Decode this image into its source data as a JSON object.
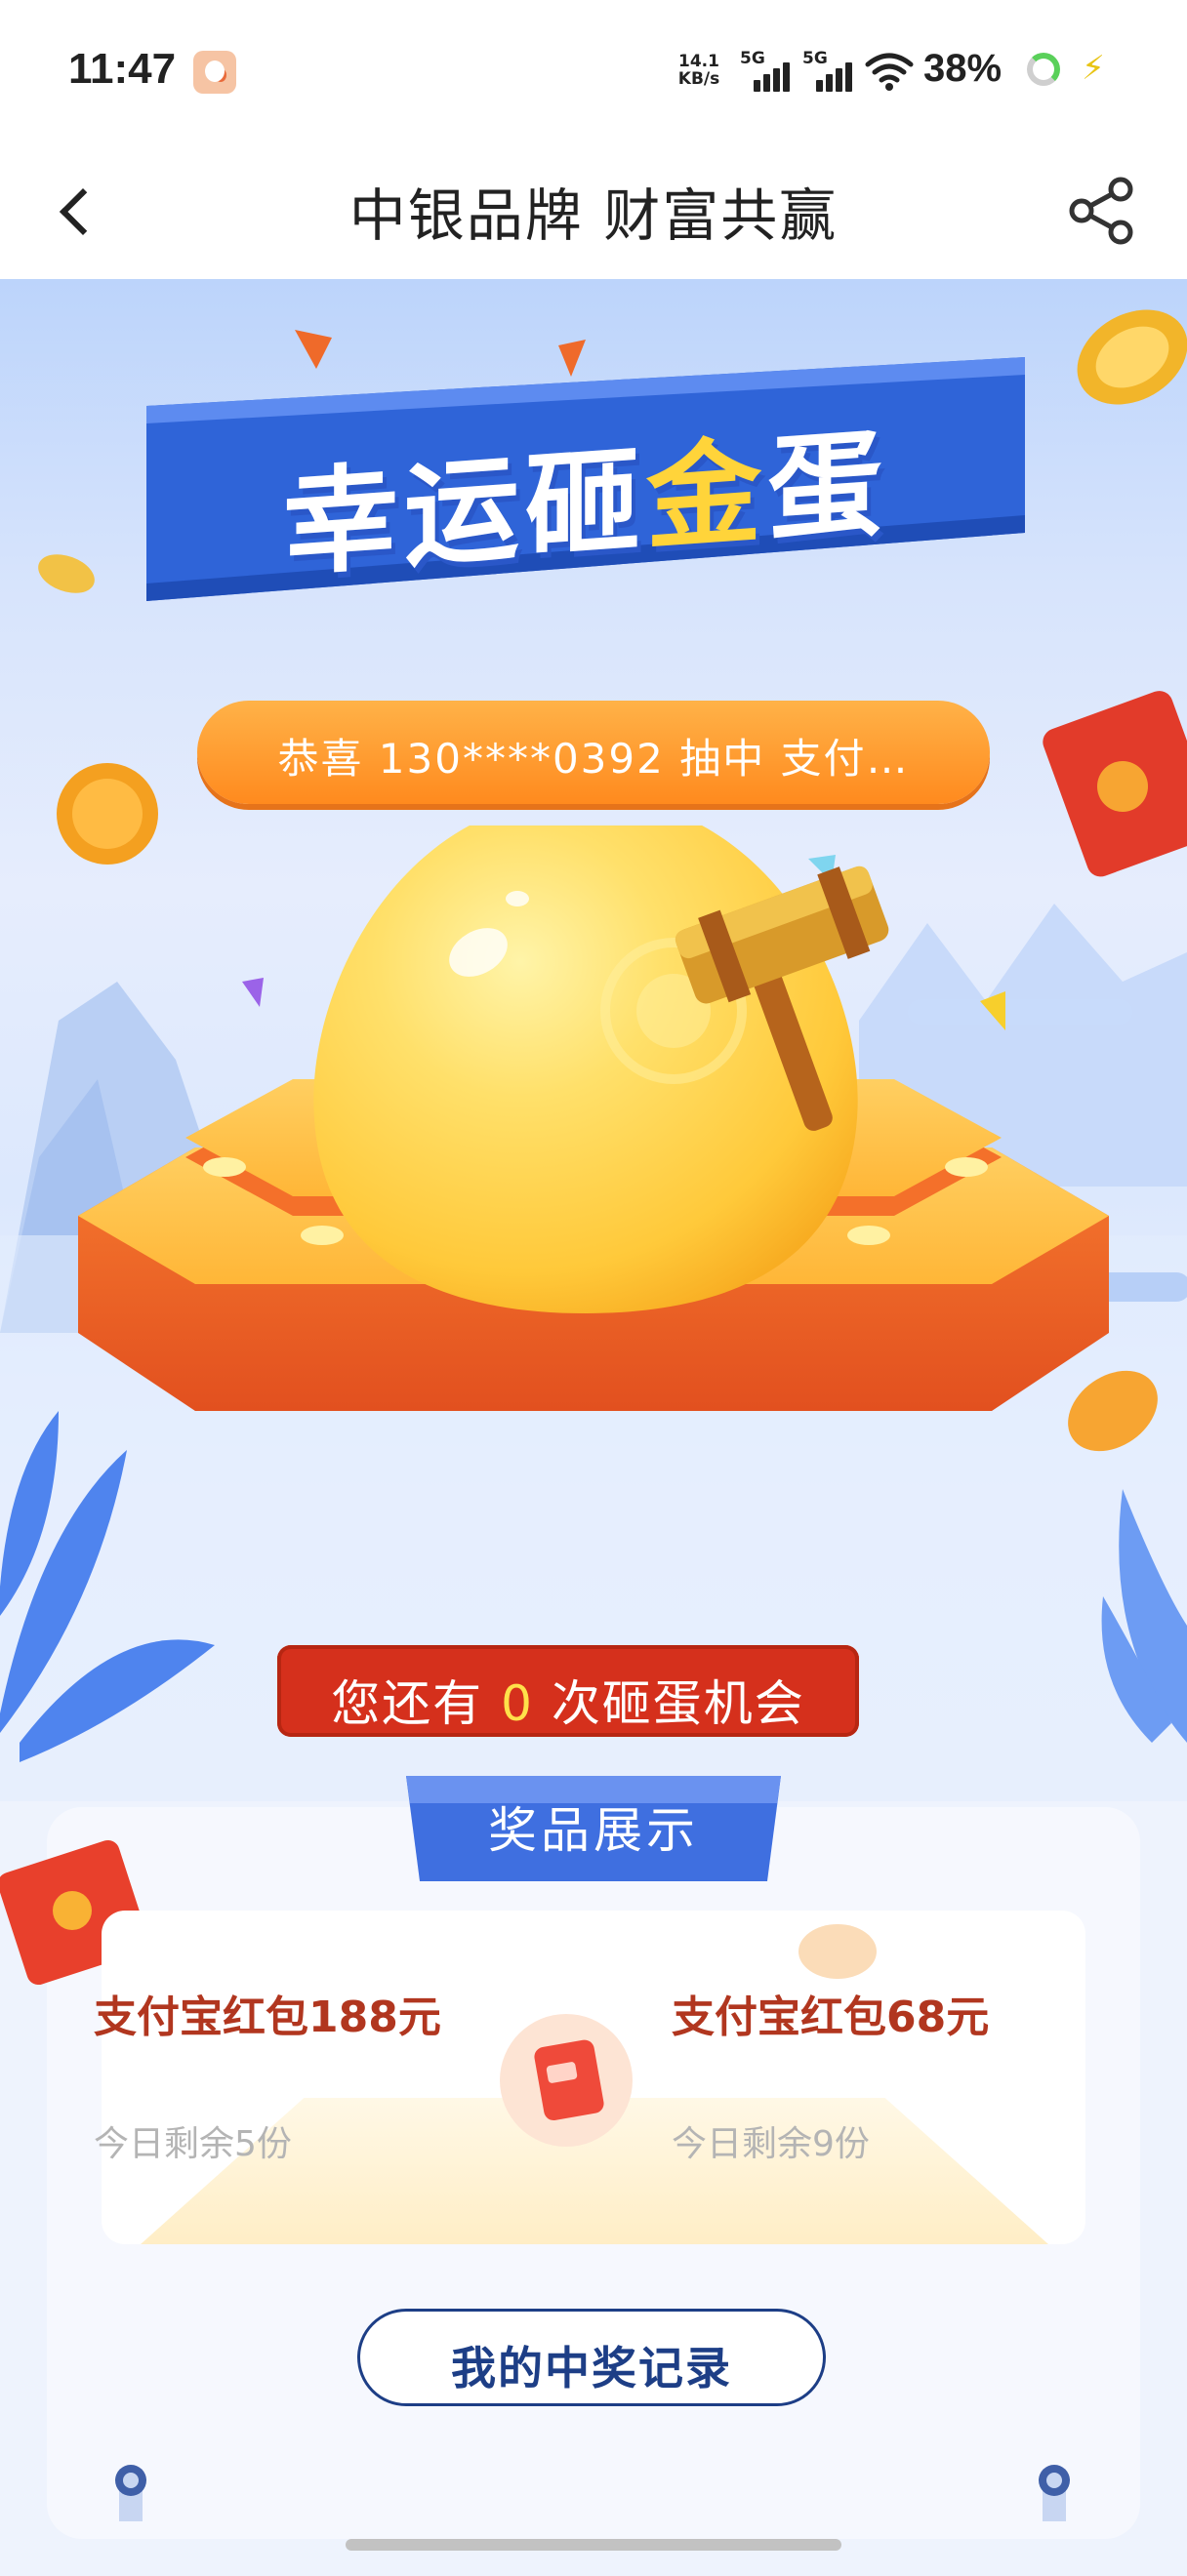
{
  "status_bar": {
    "time": "11:47",
    "net_speed_top": "14.1",
    "net_speed_bottom": "KB/s",
    "signal1_label": "5G",
    "signal2_label": "5G",
    "battery": "38%"
  },
  "header": {
    "title": "中银品牌 财富共赢"
  },
  "banner": {
    "title_part1": "幸运砸",
    "title_gold": "金",
    "title_part2": "蛋"
  },
  "ticker": {
    "text": "恭喜 130****0392 抽中 支付…"
  },
  "chance": {
    "prefix": "您还有",
    "count": "0",
    "suffix": "次砸蛋机会"
  },
  "prizes": {
    "header": "奖品展示",
    "items": [
      {
        "name": "支付宝红包188元",
        "remain": "今日剩余5份"
      },
      {
        "name": "支付宝红包68元",
        "remain": "今日剩余9份"
      }
    ]
  },
  "records_button": "我的中奖记录",
  "colors": {
    "accent_blue": "#2f64d8",
    "ticker_orange": "#ff8a1e",
    "egg_gold": "#ffc93a",
    "pedestal_orange": "#f2652a",
    "prize_red": "#b1361f",
    "button_navy": "#1d3e86"
  }
}
